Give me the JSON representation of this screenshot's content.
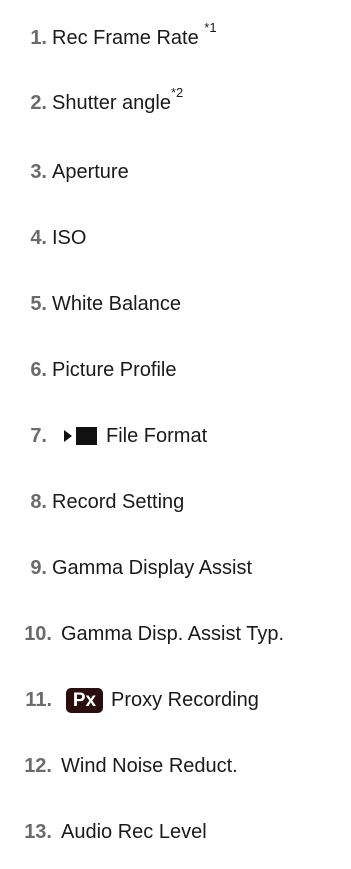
{
  "items": [
    {
      "number": "1.",
      "label": "Rec Frame Rate ",
      "note": "*1"
    },
    {
      "number": "2.",
      "label": "Shutter angle",
      "note": "*2"
    },
    {
      "number": "3.",
      "label": "Aperture"
    },
    {
      "number": "4.",
      "label": "ISO"
    },
    {
      "number": "5.",
      "label": "White Balance"
    },
    {
      "number": "6.",
      "label": "Picture Profile"
    },
    {
      "number": "7.",
      "label": "File Format",
      "icon": "movie-mode-icon"
    },
    {
      "number": "8.",
      "label": "Record Setting"
    },
    {
      "number": "9.",
      "label": "Gamma Display Assist"
    },
    {
      "number": "10.",
      "label": "Gamma Disp. Assist Typ."
    },
    {
      "number": "11.",
      "label": "Proxy Recording",
      "icon": "proxy-icon",
      "icon_text": "Px"
    },
    {
      "number": "12.",
      "label": "Wind Noise Reduct."
    },
    {
      "number": "13.",
      "label": "Audio Rec Level"
    }
  ],
  "colors": {
    "number": "#6b6b6b",
    "text": "#1a1a1a",
    "px_badge_bg": "#2a0e0e",
    "px_badge_text": "#ffffff"
  }
}
